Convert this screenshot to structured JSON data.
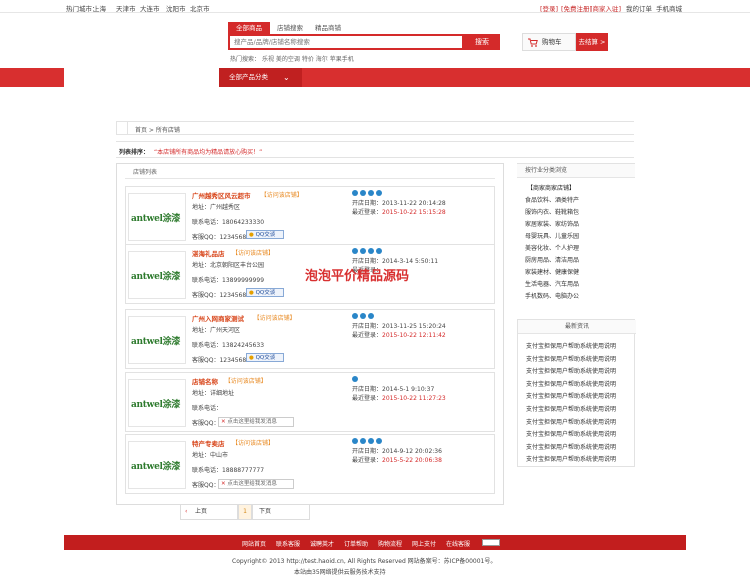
{
  "topbar": {
    "city_prefix": "热门城市：",
    "city_current": "上海",
    "cities": [
      "天津市",
      "大连市",
      "沈阳市",
      "北京市"
    ],
    "login": "[登录]",
    "register": "[免费注册]",
    "seller": "[商家入驻]",
    "my_order": "我的订单",
    "mobile": "手机商城"
  },
  "search": {
    "tabs": [
      "全部商品",
      "店铺搜索",
      "精品商铺"
    ],
    "placeholder": "搜产品/品牌/店铺名称搜索",
    "button": "搜索",
    "hot_label": "热门搜索：",
    "hot": [
      "乐视",
      "美的空调",
      "特价",
      "海尔",
      "苹果手机"
    ]
  },
  "cart": {
    "label": "购物车",
    "count_label": "去结算 >"
  },
  "nav": {
    "all_categories": "全部产品分类"
  },
  "breadcrumb": "首页 > 所有店铺",
  "list_sort": {
    "label": "列表排序：",
    "note": "本店铺所有商品均为精品请放心购买！"
  },
  "shops": {
    "header": "店铺列表",
    "items": [
      {
        "logo": "antwel涂漆",
        "name": "广州越秀区风云超市",
        "visit": "【访问该店铺】",
        "addr_label": "地址：",
        "addr": "广州越秀区",
        "phone_label": "联系电话：",
        "phone": "18064233330",
        "contact_label": "客服QQ：",
        "contact": "123456889",
        "qq_label": "QQ交谈",
        "open_label": "开店日期：",
        "open": "2013-11-22 20:14:28",
        "last_label": "最近登录：",
        "last": "2015-10-22 15:15:28",
        "crowns": 4
      },
      {
        "logo": "antwel涂漆",
        "name": "湛海礼品店",
        "visit": "【访问该店铺】",
        "addr_label": "地址：",
        "addr": "北京朝阳区丰台公园",
        "phone_label": "联系电话：",
        "phone": "13899999999",
        "contact_label": "客服QQ：",
        "contact": "123456889",
        "qq_label": "QQ交谈",
        "open_label": "开店日期：",
        "open": "2014-3-14 5:50:11",
        "last_label": "最近登录：",
        "last": "",
        "crowns": 4
      },
      {
        "logo": "antwel涂漆",
        "name": "广州入网商家测试",
        "visit": "【访问该店铺】",
        "addr_label": "地址：",
        "addr": "广州天河区",
        "phone_label": "联系电话：",
        "phone": "13824245633",
        "contact_label": "客服QQ：",
        "contact": "123456883",
        "qq_label": "QQ交谈",
        "open_label": "开店日期：",
        "open": "2013-11-25 15:20:24",
        "last_label": "最近登录：",
        "last": "2015-10-22 12:11:42",
        "crowns": 3
      },
      {
        "logo": "antwel涂漆",
        "name": "店铺名称",
        "visit": "【访问该店铺】",
        "addr_label": "地址：",
        "addr": "详细地址",
        "phone_label": "联系电话：",
        "phone": "",
        "contact_label": "客服QQ：",
        "contact": "",
        "msg": "点击这里给我发消息",
        "open_label": "开店日期：",
        "open": "2014-5-1 9:10:37",
        "last_label": "最近登录：",
        "last": "2015-10-22 11:27:23",
        "crowns": 1
      },
      {
        "logo": "antwel涂漆",
        "name": "特产专卖店",
        "visit": "【访问该店铺】",
        "addr_label": "地址：",
        "addr": "中山市",
        "phone_label": "联系电话：",
        "phone": "18888777777",
        "contact_label": "客服QQ：",
        "contact": "",
        "msg": "点击这里给我发消息",
        "open_label": "开店日期：",
        "open": "2014-9-12 20:02:36",
        "last_label": "最近登录：",
        "last": "2015-5-22 20:06:38",
        "crowns": 4
      }
    ]
  },
  "watermark": "泡泡平价精品源码",
  "right": {
    "cat_header": "按行业分类浏览",
    "cat_title": "【商家商家店铺】",
    "cats": [
      "食品饮料、酒类特产",
      "服饰内衣、鞋靴箱包",
      "家居家装、家纺饰品",
      "母婴玩具、儿童乐园",
      "美容化妆、个人护理",
      "厨房用品、清洁用品",
      "家装建材、健康保健",
      "生活电器、汽车用品",
      "手机数码、电脑办公"
    ],
    "news_header": "最新资讯",
    "news": [
      "支付宝担保用户帮助系统使用说明",
      "支付宝担保用户帮助系统使用说明",
      "支付宝担保用户帮助系统使用说明",
      "支付宝担保用户帮助系统使用说明",
      "支付宝担保用户帮助系统使用说明",
      "支付宝担保用户帮助系统使用说明",
      "支付宝担保用户帮助系统使用说明",
      "支付宝担保用户帮助系统使用说明",
      "支付宝担保用户帮助系统使用说明",
      "支付宝担保用户帮助系统使用说明"
    ]
  },
  "pager": {
    "prev": "上页",
    "current": "1",
    "next": "下页"
  },
  "footer": {
    "links": [
      "网站首页",
      "联系客服",
      "诚聘英才",
      "订单帮助",
      "购物流程",
      "网上支付",
      "在线客服"
    ],
    "copyright": "Copyright© 2013 http://test.haoid.cn, All Rights Reserved  网站备案号：苏ICP备00001号。",
    "icp": "本站由35网络提供云服务技术支持"
  }
}
